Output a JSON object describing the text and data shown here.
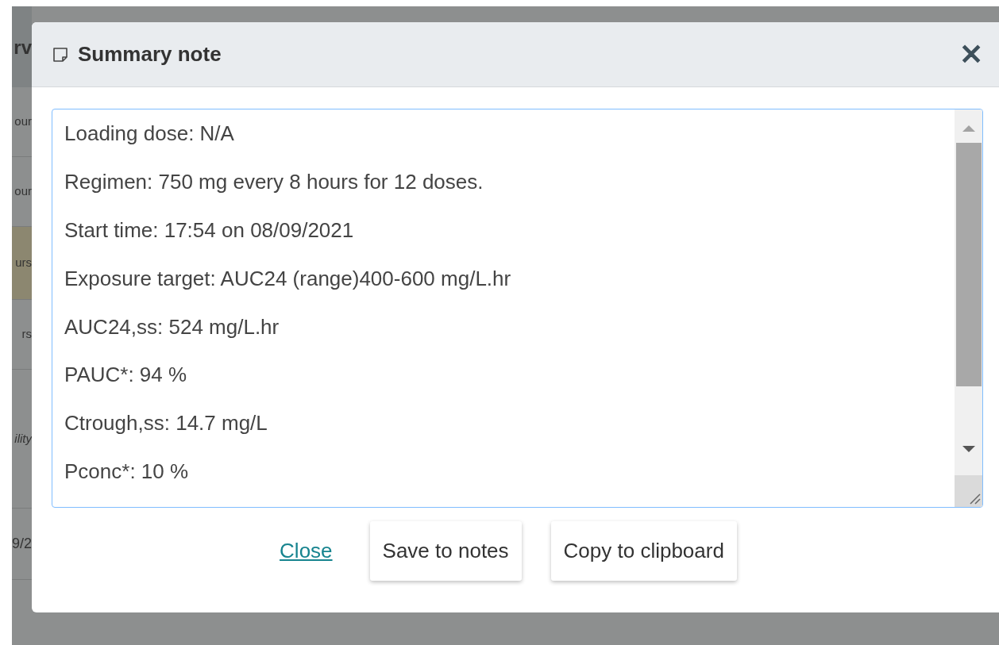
{
  "background_table": {
    "header": "rv",
    "rows": [
      {
        "text": "our",
        "highlighted": false,
        "italic": false
      },
      {
        "text": "our",
        "highlighted": false,
        "italic": false
      },
      {
        "text": "urs",
        "highlighted": true,
        "italic": false
      },
      {
        "text": "rs",
        "highlighted": false,
        "italic": false
      },
      {
        "text": "ility",
        "highlighted": false,
        "italic": true
      },
      {
        "text": "9/2",
        "highlighted": false,
        "italic": false
      }
    ]
  },
  "dialog": {
    "title": "Summary note",
    "close_icon": "✕",
    "note_lines": [
      "Loading dose: N/A",
      "Regimen: 750 mg every 8 hours for 12 doses.",
      "Start time: 17:54 on 08/09/2021",
      "Exposure target: AUC24 (range)400-600 mg/L.hr",
      "AUC24,ss: 524 mg/L.hr",
      "PAUC*: 94 %",
      "Ctrough,ss: 14.7 mg/L",
      "Pconc*: 10 %"
    ],
    "close_link": "Close",
    "buttons": [
      "Save to notes",
      "Copy to clipboard"
    ]
  }
}
